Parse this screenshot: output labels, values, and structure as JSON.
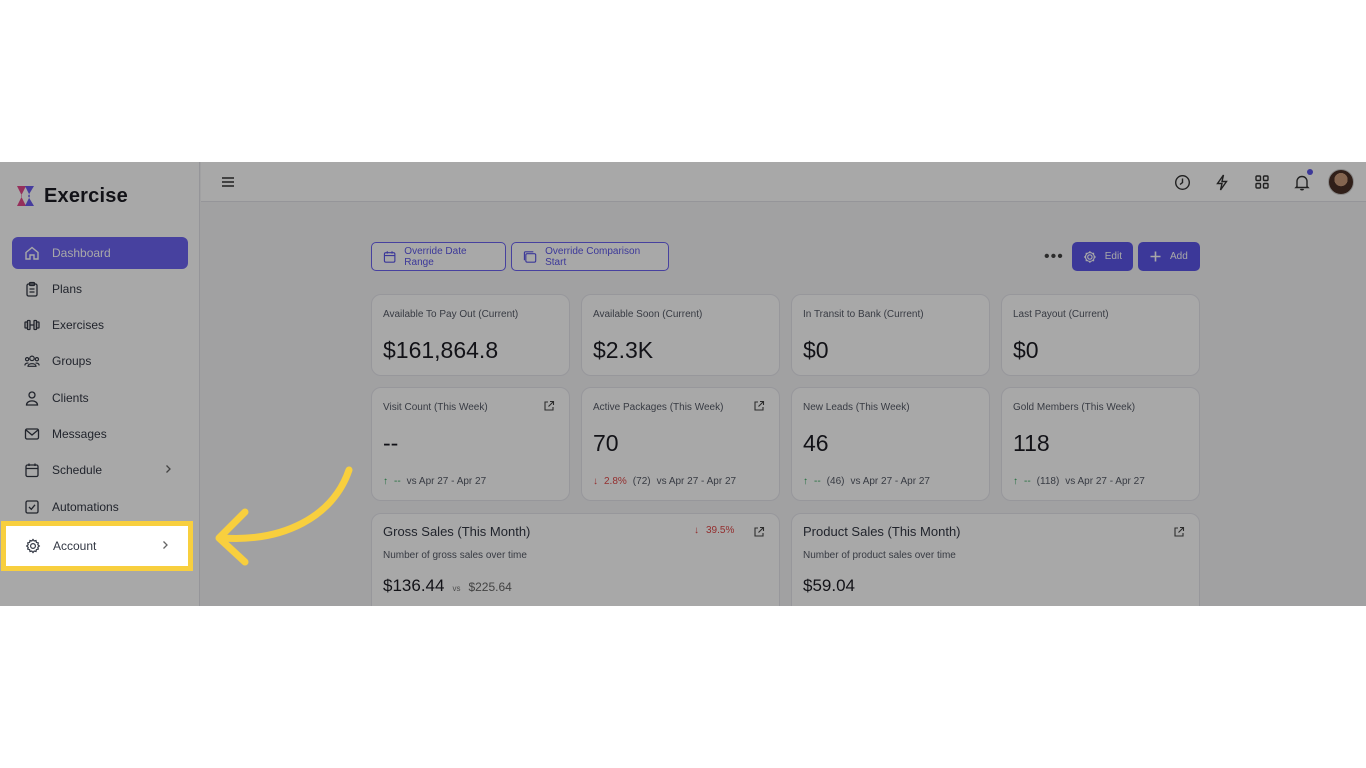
{
  "app": {
    "name": "Exercise"
  },
  "sidebar": {
    "items": [
      {
        "label": "Dashboard",
        "icon": "home-icon",
        "active": true
      },
      {
        "label": "Plans",
        "icon": "clipboard-icon"
      },
      {
        "label": "Exercises",
        "icon": "dumbbell-icon"
      },
      {
        "label": "Groups",
        "icon": "users-icon"
      },
      {
        "label": "Clients",
        "icon": "user-icon"
      },
      {
        "label": "Messages",
        "icon": "mail-icon"
      },
      {
        "label": "Schedule",
        "icon": "calendar-icon",
        "has_children": true
      },
      {
        "label": "Automations",
        "icon": "checkbox-icon"
      },
      {
        "label": "Account",
        "icon": "gear-icon",
        "has_children": true,
        "highlighted": true
      }
    ]
  },
  "toolbar": {
    "override_date_range": "Override Date Range",
    "override_comparison_start": "Override Comparison Start",
    "edit": "Edit",
    "add": "Add"
  },
  "stats_row1": [
    {
      "title": "Available To Pay Out (Current)",
      "value": "$161,864.8"
    },
    {
      "title": "Available Soon (Current)",
      "value": "$2.3K"
    },
    {
      "title": "In Transit to Bank (Current)",
      "value": "$0"
    },
    {
      "title": "Last Payout (Current)",
      "value": "$0"
    }
  ],
  "stats_row2": [
    {
      "title": "Visit Count (This Week)",
      "value": "--",
      "trend": "up",
      "change": "--",
      "prev": "",
      "range": "vs Apr 27 - Apr 27"
    },
    {
      "title": "Active Packages (This Week)",
      "value": "70",
      "trend": "down",
      "change": "2.8%",
      "prev": "(72)",
      "range": "vs Apr 27 - Apr 27"
    },
    {
      "title": "New Leads (This Week)",
      "value": "46",
      "trend": "up",
      "change": "--",
      "prev": "(46)",
      "range": "vs Apr 27 - Apr 27"
    },
    {
      "title": "Gold Members (This Week)",
      "value": "118",
      "trend": "up",
      "change": "--",
      "prev": "(118)",
      "range": "vs Apr 27 - Apr 27"
    }
  ],
  "gross_sales": {
    "title": "Gross Sales (This Month)",
    "change": "39.5%",
    "subtitle": "Number of gross sales over time",
    "value": "$136.44",
    "vs": "vs",
    "compare": "$225.64"
  },
  "product_sales": {
    "title": "Product Sales (This Month)",
    "subtitle": "Number of product sales over time",
    "value": "$59.04"
  },
  "colors": {
    "accent": "#5b55e8",
    "highlight": "#f8cf3e",
    "up": "#2faa5a",
    "down": "#e04848"
  }
}
